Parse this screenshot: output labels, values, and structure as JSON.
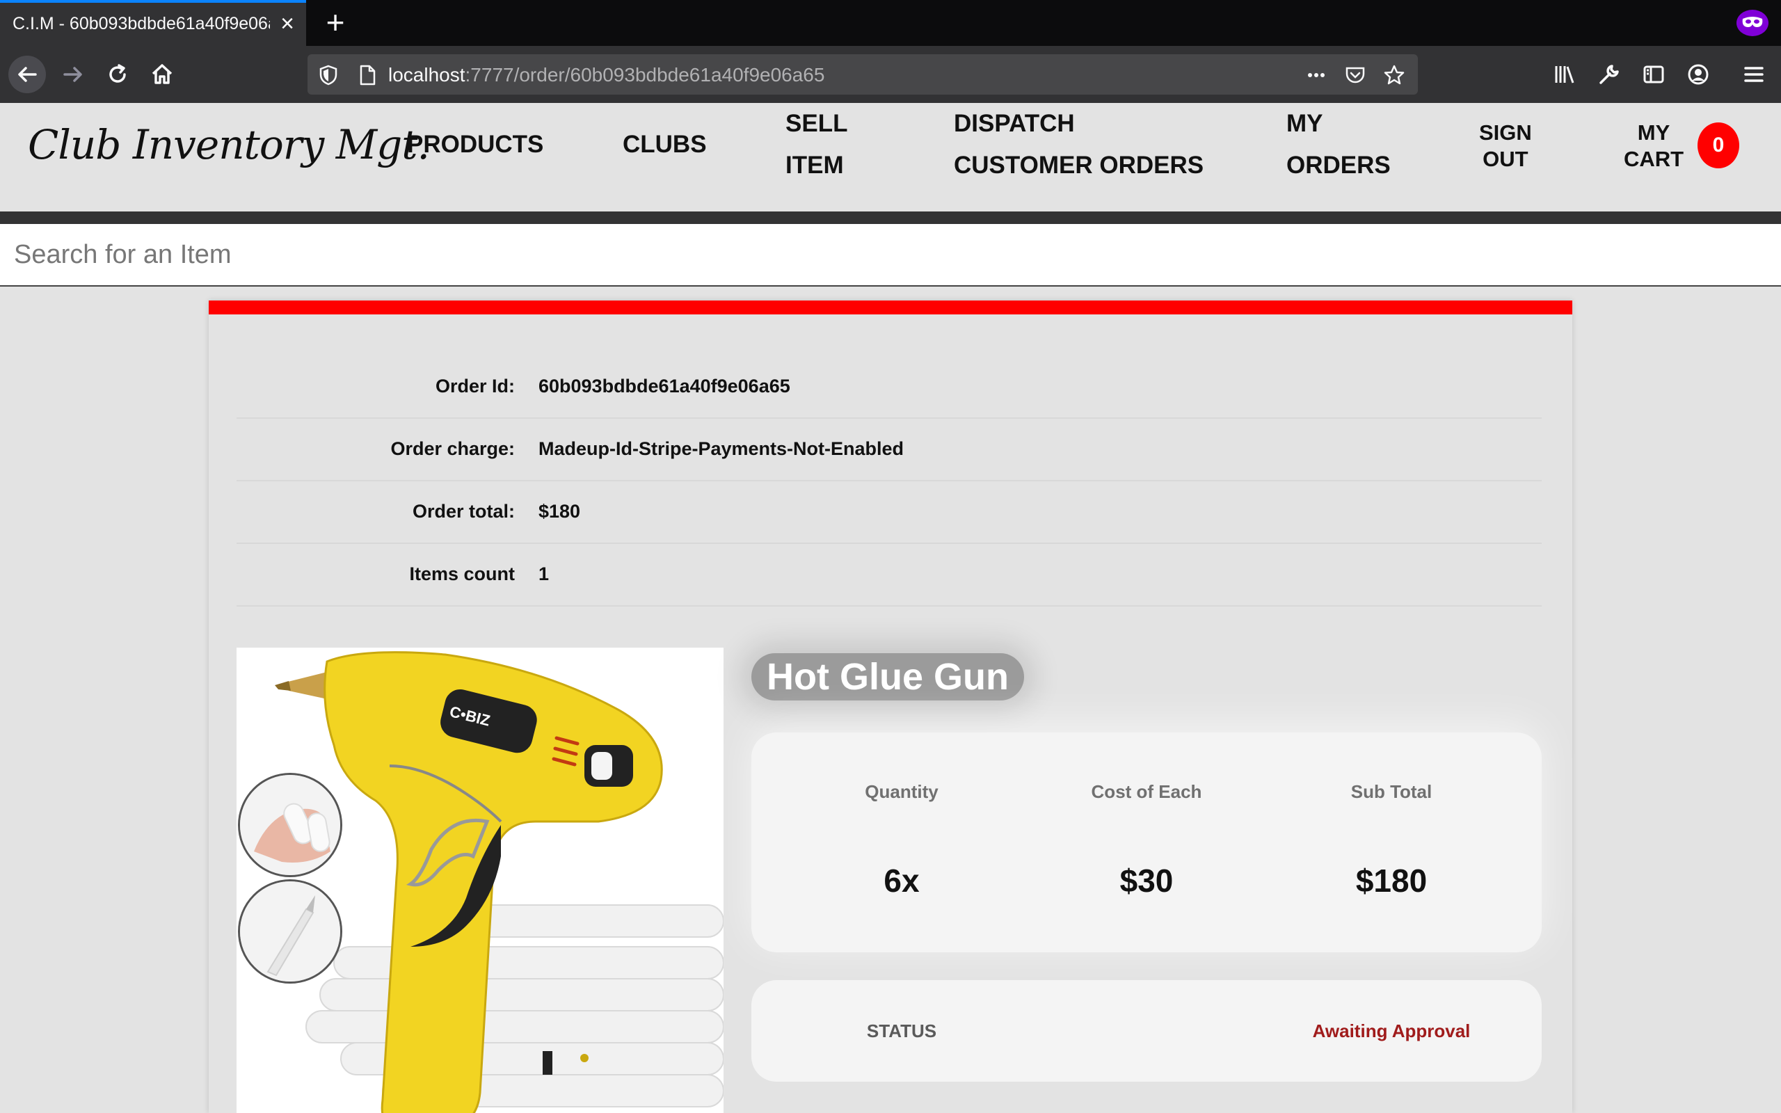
{
  "browser": {
    "tab_title": "C.I.M - 60b093bdbde61a40f9e06a65",
    "url_host": "localhost",
    "url_path": ":7777/order/60b093bdbde61a40f9e06a65"
  },
  "nav": {
    "logo": "Club Inventory Mgt.",
    "products": "PRODUCTS",
    "clubs": "CLUBS",
    "sell_line1": "SELL",
    "sell_line2": "ITEM",
    "dispatch_line1": "DISPATCH",
    "dispatch_line2": "CUSTOMER ORDERS",
    "my_orders_line1": "MY",
    "my_orders_line2": "ORDERS",
    "sign_out_line1": "SIGN",
    "sign_out_line2": "OUT",
    "cart_line1": "MY",
    "cart_line2": "CART",
    "cart_count": "0"
  },
  "search": {
    "placeholder": "Search for an Item"
  },
  "order": {
    "rows": [
      {
        "label": "Order Id:",
        "value": "60b093bdbde61a40f9e06a65"
      },
      {
        "label": "Order charge:",
        "value": "Madeup-Id-Stripe-Payments-Not-Enabled"
      },
      {
        "label": "Order total:",
        "value": "$180"
      },
      {
        "label": "Items count",
        "value": "1"
      }
    ]
  },
  "item": {
    "title": "Hot Glue Gun",
    "brand_text": "C•BIZ",
    "quantity_label": "Quantity",
    "quantity_value": "6x",
    "cost_label": "Cost of Each",
    "cost_value": "$30",
    "subtotal_label": "Sub Total",
    "subtotal_value": "$180",
    "status_label": "STATUS",
    "status_value": "Awaiting Approval"
  },
  "colors": {
    "accent_red": "#ff0000",
    "status_red": "#a01c1c",
    "tab_highlight": "#0a84ff",
    "private_purple": "#8000d7"
  }
}
